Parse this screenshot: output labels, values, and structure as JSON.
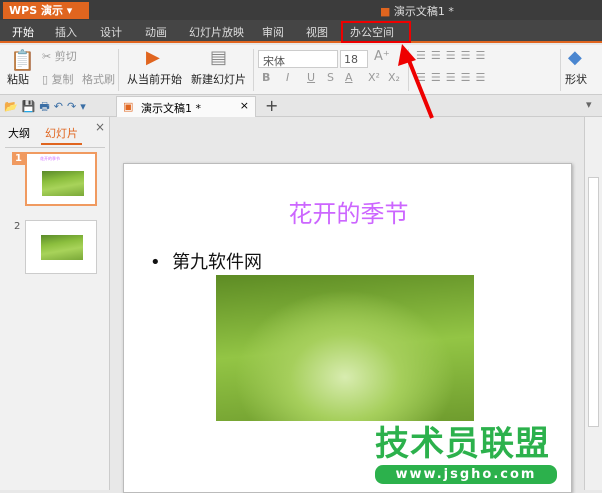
{
  "app": {
    "logo": "WPS 演示",
    "doc_title": "演示文稿1 *"
  },
  "tabs": [
    "开始",
    "插入",
    "设计",
    "动画",
    "幻灯片放映",
    "审阅",
    "视图",
    "办公空间"
  ],
  "ribbon": {
    "paste": "粘贴",
    "cut": "剪切",
    "copy": "复制",
    "format_painter": "格式刷",
    "from_current": "从当前开始",
    "new_slide": "新建幻灯片",
    "font": "宋体",
    "size": "18",
    "bold": "B",
    "italic": "I",
    "underline": "U",
    "strike": "S",
    "fontcolor": "A",
    "sup": "X²",
    "sub": "X₂",
    "grow": "A⁺",
    "shape": "形状"
  },
  "doc_tab": {
    "label": "演示文稿1 *",
    "close": "×",
    "add": "+"
  },
  "panel": {
    "tab_outline": "大纲",
    "tab_slides": "幻灯片",
    "close": "×",
    "slide_numbers": [
      "1",
      "2"
    ]
  },
  "slide": {
    "title": "花开的季节",
    "bullet": "第九软件网"
  },
  "colors": {
    "accent": "#e0651f",
    "title": "#cc66ff",
    "highlight": "#e00000"
  },
  "watermark": {
    "brand": "技术员联盟",
    "url": "www.jsgho.com"
  }
}
